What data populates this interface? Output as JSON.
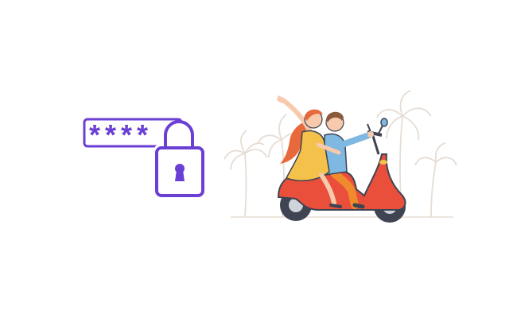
{
  "password_graphic": {
    "mask_text": "****",
    "accent_color": "#6b3fd4",
    "icon": "padlock-icon"
  },
  "scene": {
    "scooter_color": "#e94f3b",
    "scooter_dark": "#3f4452",
    "rider_woman_dress": "#f4c24a",
    "rider_woman_hair": "#e8693c",
    "rider_man_shirt": "#7fb8e0",
    "rider_man_pants": "#f08a2c",
    "palm_color": "#e6ddd4",
    "skin_color": "#f7c9ad"
  }
}
